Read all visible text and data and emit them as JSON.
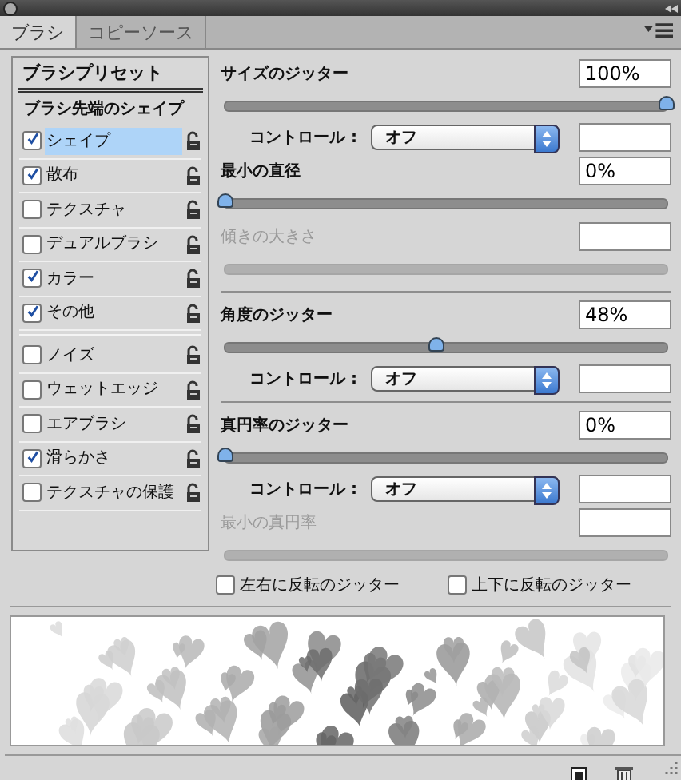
{
  "tabs": [
    {
      "label": "ブラシ",
      "selected": true
    },
    {
      "label": "コピーソース",
      "selected": false
    }
  ],
  "sidebar": {
    "preset_button": "ブラシプリセット",
    "groups": [
      [
        {
          "kind": "header",
          "label": "ブラシ先端のシェイプ"
        },
        {
          "kind": "option",
          "label": "シェイプ",
          "checked": true,
          "selected": true
        },
        {
          "kind": "option",
          "label": "散布",
          "checked": true,
          "selected": false
        },
        {
          "kind": "option",
          "label": "テクスチャ",
          "checked": false,
          "selected": false
        },
        {
          "kind": "option",
          "label": "デュアルブラシ",
          "checked": false,
          "selected": false
        },
        {
          "kind": "option",
          "label": "カラー",
          "checked": true,
          "selected": false
        },
        {
          "kind": "option",
          "label": "その他",
          "checked": true,
          "selected": false
        }
      ],
      [
        {
          "kind": "option",
          "label": "ノイズ",
          "checked": false,
          "selected": false
        },
        {
          "kind": "option",
          "label": "ウェットエッジ",
          "checked": false,
          "selected": false
        },
        {
          "kind": "option",
          "label": "エアブラシ",
          "checked": false,
          "selected": false
        },
        {
          "kind": "option",
          "label": "滑らかさ",
          "checked": true,
          "selected": false
        },
        {
          "kind": "option",
          "label": "テクスチャの保護",
          "checked": false,
          "selected": false
        }
      ]
    ]
  },
  "sections": [
    [
      {
        "kind": "slider",
        "label": "サイズのジッター",
        "value": "100%",
        "level": 1,
        "disabled": false
      },
      {
        "kind": "control",
        "label": "コントロール :",
        "value": "オフ"
      },
      {
        "kind": "slider",
        "label": "最小の直径",
        "value": "0%",
        "level": 0,
        "disabled": false
      },
      {
        "kind": "slider",
        "label": "傾きの大きさ",
        "disabled": true
      }
    ],
    [
      {
        "kind": "slider",
        "label": "角度のジッター",
        "value": "48%",
        "level": 0.48,
        "disabled": false
      },
      {
        "kind": "control",
        "label": "コントロール :",
        "value": "オフ"
      }
    ],
    [
      {
        "kind": "slider",
        "label": "真円率のジッター",
        "value": "0%",
        "level": 0,
        "disabled": false
      },
      {
        "kind": "control",
        "label": "コントロール :",
        "value": "オフ"
      },
      {
        "kind": "slider",
        "label": "最小の真円率",
        "disabled": true
      }
    ]
  ],
  "flips": [
    {
      "label": "左右に反転のジッター",
      "checked": false
    },
    {
      "label": "上下に反転のジッター",
      "checked": false
    }
  ]
}
